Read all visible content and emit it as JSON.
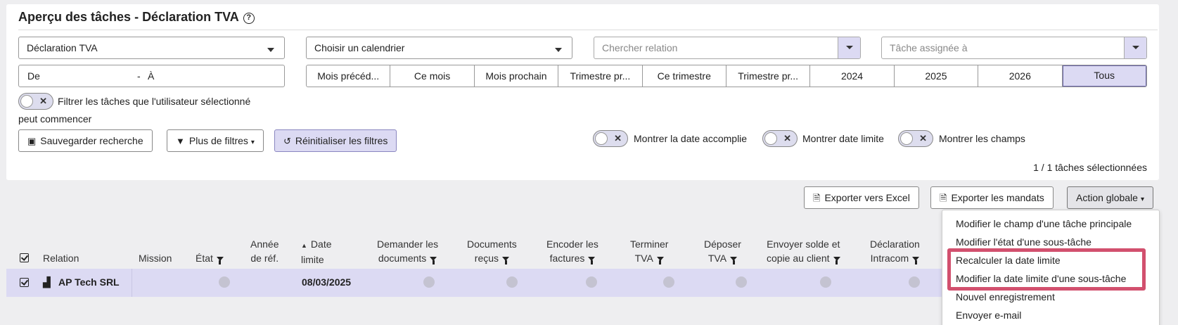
{
  "header": {
    "title": "Aperçu des tâches - Déclaration TVA"
  },
  "filters": {
    "type_select": "Déclaration TVA",
    "calendar_select": "Choisir un calendrier",
    "relation_placeholder": "Chercher relation",
    "assigned_placeholder": "Tâche assignée à",
    "date_from": "De",
    "date_to": "À",
    "periods": [
      "Mois précéd...",
      "Ce mois",
      "Mois prochain",
      "Trimestre pr...",
      "Ce trimestre",
      "Trimestre pr...",
      "2024",
      "2025",
      "2026",
      "Tous"
    ],
    "toggle_filter_label_1": "Filtrer les tâches que l'utilisateur sélectionné",
    "toggle_filter_label_2": "peut commencer",
    "save_search": "Sauvegarder recherche",
    "more_filters": "Plus de filtres",
    "reset_filters": "Réinitialiser les filtres",
    "show_completed": "Montrer la date accomplie",
    "show_deadline": "Montrer date limite",
    "show_fields": "Montrer les champs",
    "selected_count": "1 / 1 tâches sélectionnées"
  },
  "toolbar": {
    "export_excel": "Exporter vers Excel",
    "export_mandates": "Exporter les mandats",
    "global_action": "Action globale"
  },
  "table": {
    "headers": {
      "relation": "Relation",
      "mission": "Mission",
      "etat": "État",
      "annee_1": "Année",
      "annee_2": "de réf.",
      "date_1": "Date",
      "date_2": "limite",
      "demander_1": "Demander les",
      "demander_2": "documents",
      "docs_1": "Documents",
      "docs_2": "reçus",
      "encoder_1": "Encoder les",
      "encoder_2": "factures",
      "terminer_1": "Terminer",
      "terminer_2": "TVA",
      "deposer_1": "Déposer",
      "deposer_2": "TVA",
      "envoyer_1": "Envoyer solde et",
      "envoyer_2": "copie au client",
      "intracom_1": "Déclaration",
      "intracom_2": "Intracom"
    },
    "row": {
      "relation": "AP Tech SRL",
      "date": "08/03/2025"
    }
  },
  "menu": {
    "items": [
      "Modifier le champ d'une tâche principale",
      "Modifier l'état d'une sous-tâche",
      "Recalculer la date limite",
      "Modifier la date limite d'une sous-tâche",
      "Nouvel enregistrement",
      "Envoyer e-mail"
    ]
  }
}
